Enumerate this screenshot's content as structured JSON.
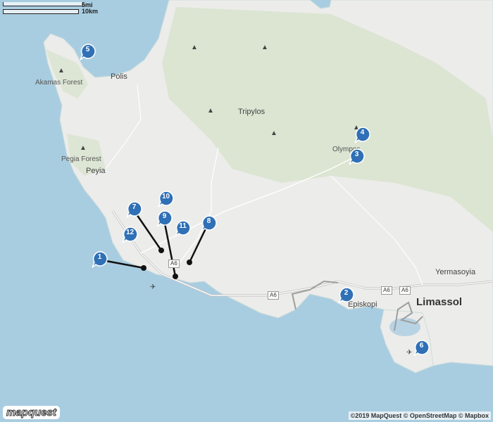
{
  "scale": {
    "miles": "5mi",
    "km": "10km"
  },
  "places": {
    "polis": "Polis",
    "akamas": "Akamas Forest",
    "tripylos": "Tripylos",
    "pegia_forest": "Pegia Forest",
    "peyia": "Peyia",
    "olympos": "Olympos",
    "yermasoyia": "Yermasoyia",
    "episkopi": "Episkopi",
    "limassol": "Limassol"
  },
  "roads": {
    "a6_west": "A6",
    "a6_mid": "A6",
    "a6_east1": "A6",
    "a6_east2": "A6"
  },
  "markers": [
    "1",
    "2",
    "3",
    "4",
    "5",
    "6",
    "7",
    "8",
    "9",
    "10",
    "11",
    "12"
  ],
  "logo": "mapquest",
  "attribution": "©2019 MapQuest © OpenStreetMap © Mapbox",
  "colors": {
    "water": "#a9cde0",
    "land": "#ececea",
    "marker": "#2f70b6",
    "road": "#e6e6e6"
  }
}
